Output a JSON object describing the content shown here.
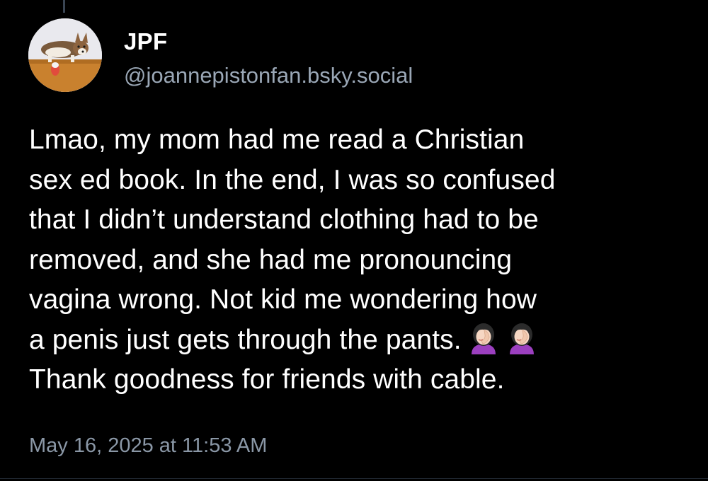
{
  "post": {
    "author_name": "JPF",
    "author_handle": "@joannepistonfan.bsky.social",
    "text_lines": [
      "Lmao, my mom had me read a Christian",
      "sex ed book. In the end, I was so confused",
      "that I didn’t understand clothing had to be",
      "removed, and she had me pronouncing",
      "vagina wrong. Not kid me wondering how",
      "a penis just gets through the pants."
    ],
    "text_last_line": "Thank goodness for friends with cable.",
    "emojis": [
      "woman-facepalming-icon",
      "woman-facepalming-icon"
    ],
    "timestamp": "May 16, 2025 at 11:53 AM"
  },
  "colors": {
    "background": "#000000",
    "primary_text": "#ffffff",
    "handle_text": "#9aa7b6",
    "timestamp_text": "#8a97a6"
  }
}
